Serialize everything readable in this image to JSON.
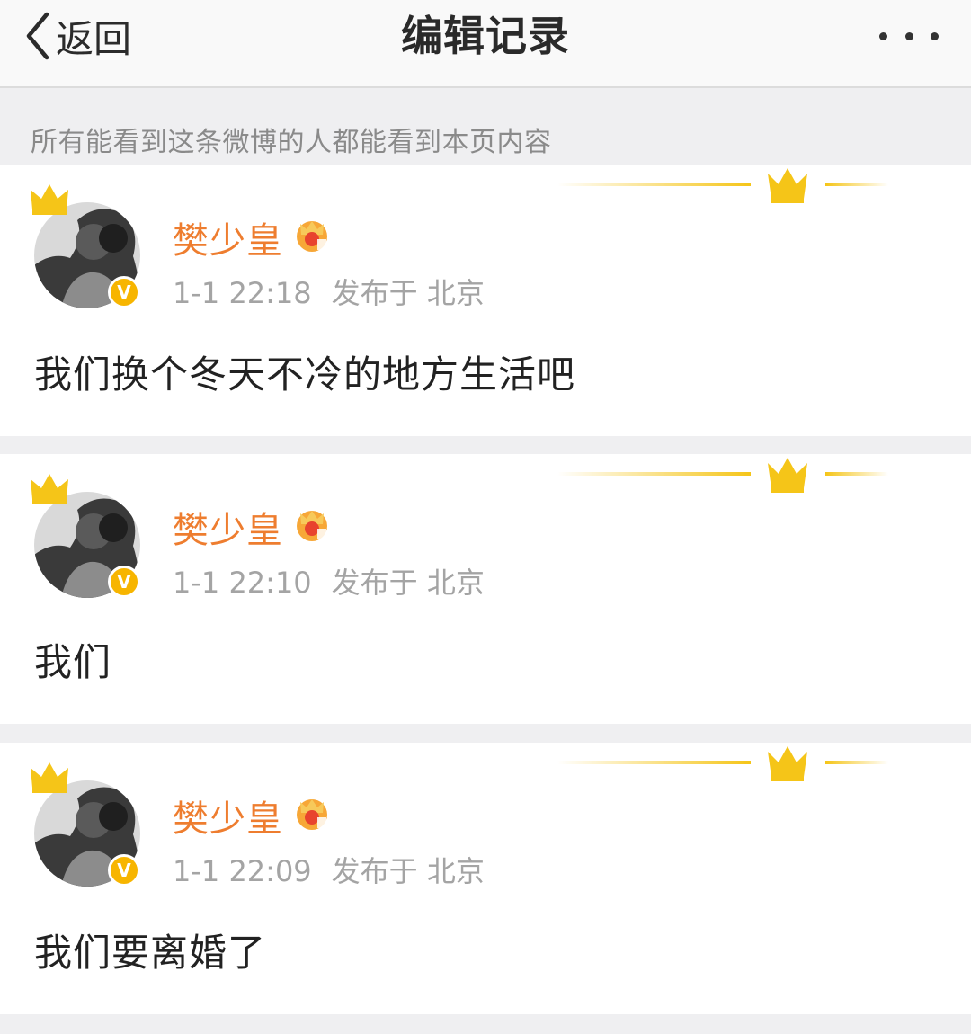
{
  "nav": {
    "back_label": "返回",
    "title": "编辑记录",
    "more_icon": "more-dots-icon"
  },
  "notice": "所有能看到这条微博的人都能看到本页内容",
  "colors": {
    "username": "#ee7d2f",
    "verify_badge": "#f7b500",
    "crown_gold": "#f5c518",
    "background": "#efeff1"
  },
  "posts": [
    {
      "username": "樊少皇",
      "time": "1-1 22:18",
      "location": "发布于 北京",
      "text": "我们换个冬天不冷的地方生活吧"
    },
    {
      "username": "樊少皇",
      "time": "1-1 22:10",
      "location": "发布于 北京",
      "text": "我们"
    },
    {
      "username": "樊少皇",
      "time": "1-1 22:09",
      "location": "发布于 北京",
      "text": "我们要离婚了"
    }
  ],
  "verify_mark": "V"
}
